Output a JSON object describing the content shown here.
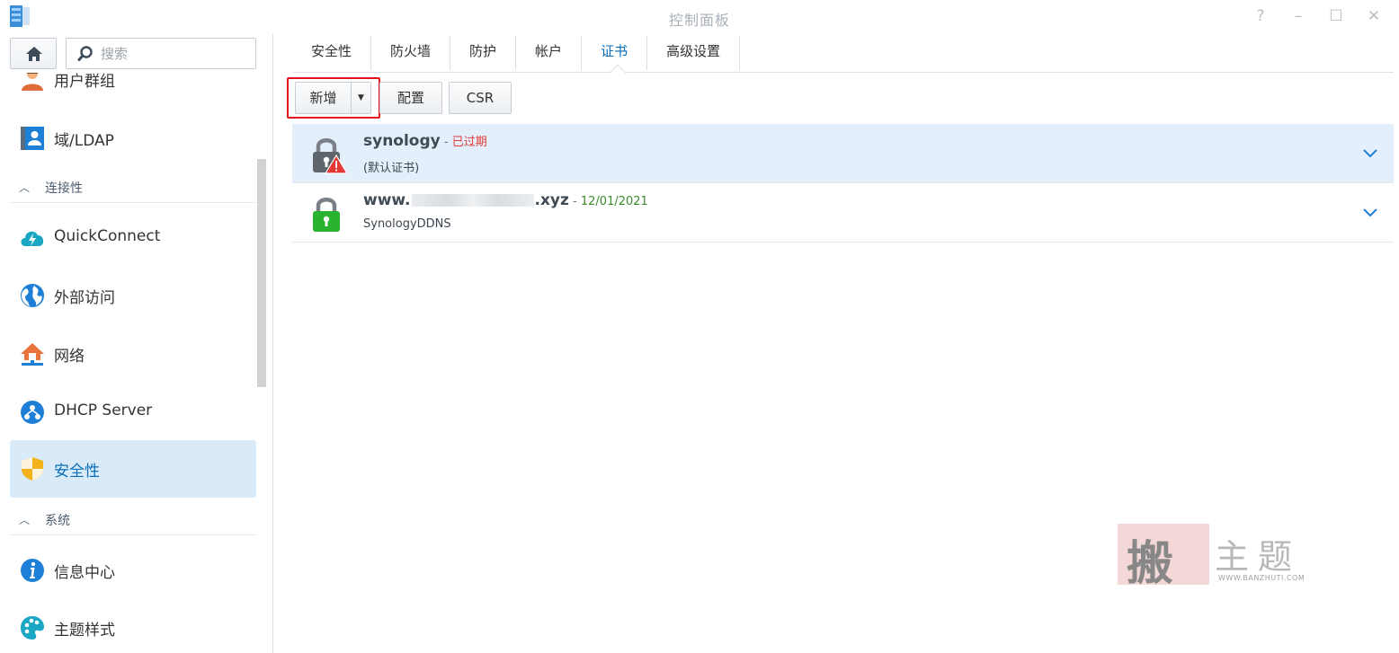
{
  "window": {
    "title": "控制面板",
    "controls": [
      "?",
      "–",
      "☐",
      "✕"
    ]
  },
  "sidebar": {
    "search_placeholder": "搜索",
    "items_top": [
      {
        "label": "用户群组",
        "icon": "user-group-icon"
      },
      {
        "label": "域/LDAP",
        "icon": "domain-ldap-icon"
      }
    ],
    "section_connectivity": "连接性",
    "items_connectivity": [
      {
        "label": "QuickConnect",
        "icon": "quickconnect-icon"
      },
      {
        "label": "外部访问",
        "icon": "external-access-icon"
      },
      {
        "label": "网络",
        "icon": "network-icon"
      },
      {
        "label": "DHCP Server",
        "icon": "dhcp-server-icon"
      },
      {
        "label": "安全性",
        "icon": "security-shield-icon",
        "active": true
      }
    ],
    "section_system": "系统",
    "items_system": [
      {
        "label": "信息中心",
        "icon": "info-center-icon"
      },
      {
        "label": "主题样式",
        "icon": "theme-style-icon"
      }
    ]
  },
  "tabs": [
    "安全性",
    "防火墙",
    "防护",
    "帐户",
    "证书",
    "高级设置"
  ],
  "active_tab": "证书",
  "toolbar": {
    "new_label": "新增",
    "config_label": "配置",
    "csr_label": "CSR"
  },
  "certificates": [
    {
      "name": "synology",
      "separator": " - ",
      "status": "已过期",
      "status_color": "#e53935",
      "subtitle": "(默认证书)",
      "state": "expired",
      "selected": true
    },
    {
      "name_prefix": "www.",
      "name_suffix": ".xyz",
      "separator": " - ",
      "status": "12/01/2021",
      "status_color": "#3c8b2c",
      "subtitle": "SynologyDDNS",
      "state": "valid",
      "selected": false
    }
  ],
  "watermark": {
    "seal": "搬",
    "title": "主题",
    "url": "WWW.BANZHUTI.COM"
  },
  "colors": {
    "accent": "#0a6eb8",
    "active_bg": "#d9eaf8",
    "selected_row": "#e3f0fb",
    "highlight": "#e5121b"
  }
}
